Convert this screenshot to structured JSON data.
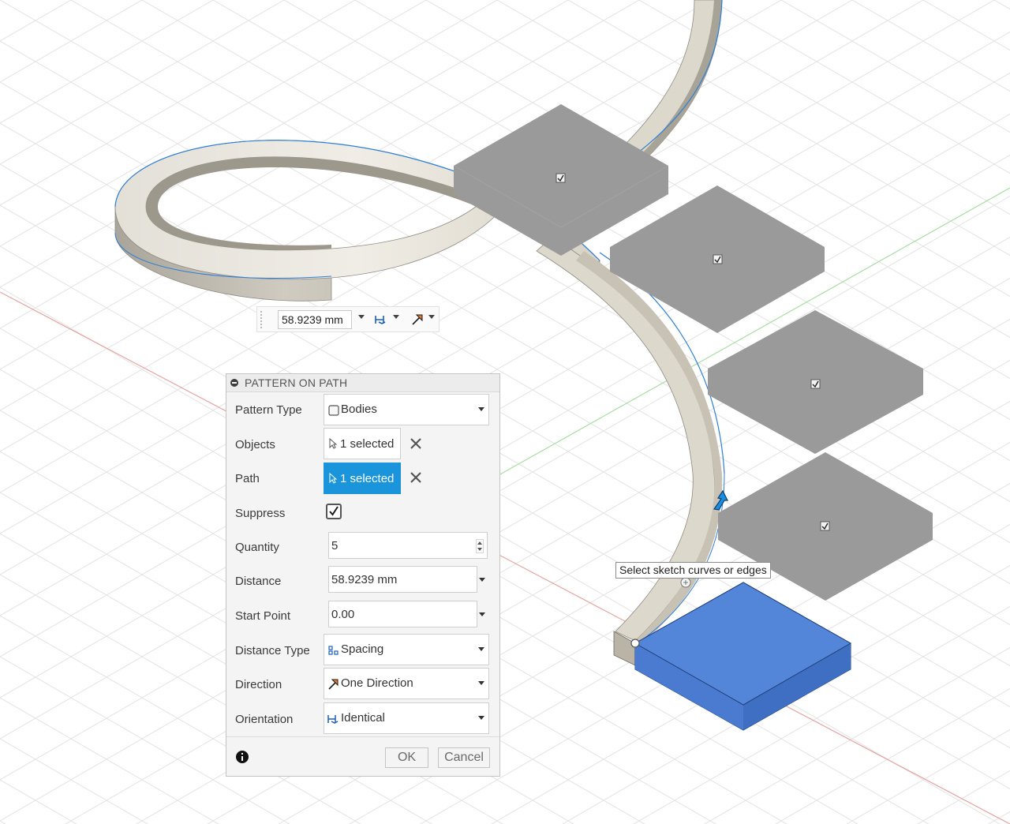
{
  "toolbar": {
    "distance_value": "58.9239 mm",
    "orientation_icon": "orientation-identical-icon",
    "direction_icon": "direction-one-icon"
  },
  "dialog": {
    "title": "PATTERN ON PATH",
    "rows": {
      "pattern_type": {
        "label": "Pattern Type",
        "value": "Bodies",
        "icon": "bodies-icon"
      },
      "objects": {
        "label": "Objects",
        "value": "1 selected",
        "icon": "cursor-icon"
      },
      "path": {
        "label": "Path",
        "value": "1 selected",
        "icon": "cursor-icon",
        "active": true
      },
      "suppress": {
        "label": "Suppress",
        "checked": true
      },
      "quantity": {
        "label": "Quantity",
        "value": "5"
      },
      "distance": {
        "label": "Distance",
        "value": "58.9239 mm"
      },
      "start_point": {
        "label": "Start Point",
        "value": "0.00"
      },
      "distance_type": {
        "label": "Distance Type",
        "value": "Spacing",
        "icon": "spacing-icon"
      },
      "direction": {
        "label": "Direction",
        "value": "One Direction",
        "icon": "one-direction-icon"
      },
      "orientation": {
        "label": "Orientation",
        "value": "Identical",
        "icon": "identical-icon"
      }
    },
    "ok_label": "OK",
    "cancel_label": "Cancel"
  },
  "viewport": {
    "tooltip": "Select sketch curves or edges",
    "pattern_instances": [
      {
        "suppress_checked": true
      },
      {
        "suppress_checked": true
      },
      {
        "suppress_checked": true
      },
      {
        "suppress_checked": true
      }
    ]
  },
  "colors": {
    "accent": "#1a95dc",
    "selected_body": "#4f82d6",
    "preview_body": "#9a9a9a",
    "path_body": "#d6d1c5",
    "grid": "#e4e4e4",
    "x_axis": "#e59a9a",
    "y_axis": "#a7dca2"
  }
}
